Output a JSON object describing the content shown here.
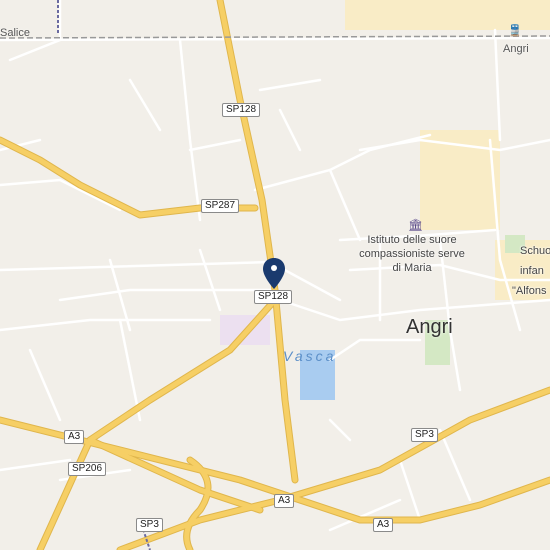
{
  "map": {
    "places": {
      "salice": "Salice",
      "angri_station": "Angri",
      "angri": "Angri",
      "vasca": "Vasca",
      "istituto": "Istituto delle suore compassioniste serve di Maria",
      "scuola_1": "Schuo",
      "scuola_2": "infan",
      "scuola_3": "\"Alfons"
    },
    "roads": {
      "sp128_north": "SP128",
      "sp128_south": "SP128",
      "sp287": "SP287",
      "a3_west": "A3",
      "a3_mid": "A3",
      "a3_east": "A3",
      "sp206": "SP206",
      "sp3_west": "SP3",
      "sp3_east": "SP3"
    },
    "icons": {
      "marker": "location-pin-icon",
      "poi": "building-icon",
      "station": "train-icon"
    },
    "colors": {
      "land": "#f2efe9",
      "road_major": "#f6cf65",
      "road_minor": "#ffffff",
      "water": "#a9ccf0",
      "marker": "#1a3a6e",
      "urban": "#f9ecc6",
      "park": "#d4e8c4"
    }
  }
}
